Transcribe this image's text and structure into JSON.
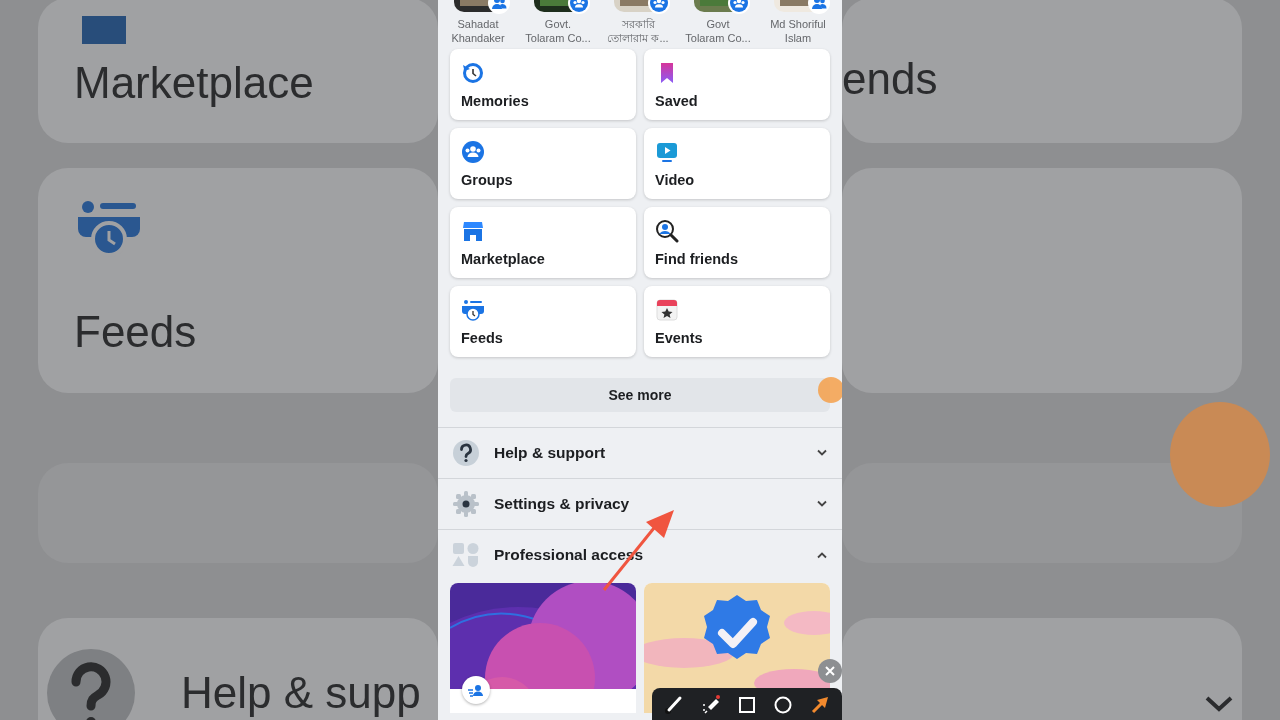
{
  "backdrop": {
    "left_labels": [
      "Marketplace",
      "Feeds",
      "Help & supp"
    ],
    "right_labels": [
      "ends"
    ]
  },
  "shortcuts": [
    {
      "lines": [
        "Sahadat",
        "Khandaker"
      ],
      "kind": "profile"
    },
    {
      "lines": [
        "Govt.",
        "Tolaram Co..."
      ],
      "kind": "group"
    },
    {
      "lines": [
        "সরকারি",
        "তোলারাম ক..."
      ],
      "kind": "group"
    },
    {
      "lines": [
        "Govt",
        "Tolaram Co..."
      ],
      "kind": "group"
    },
    {
      "lines": [
        "Md Shoriful",
        "Islam"
      ],
      "kind": "profile"
    }
  ],
  "menu": [
    {
      "label": "Memories",
      "kind": "memories"
    },
    {
      "label": "Saved",
      "kind": "saved"
    },
    {
      "label": "Groups",
      "kind": "groups"
    },
    {
      "label": "Video",
      "kind": "video"
    },
    {
      "label": "Marketplace",
      "kind": "marketplace"
    },
    {
      "label": "Find friends",
      "kind": "friends"
    },
    {
      "label": "Feeds",
      "kind": "feeds"
    },
    {
      "label": "Events",
      "kind": "events"
    }
  ],
  "see_more": "See more",
  "sections": [
    {
      "label": "Help & support",
      "kind": "help",
      "expanded": false
    },
    {
      "label": "Settings & privacy",
      "kind": "settings",
      "expanded": false
    },
    {
      "label": "Professional access",
      "kind": "professional",
      "expanded": true
    }
  ]
}
